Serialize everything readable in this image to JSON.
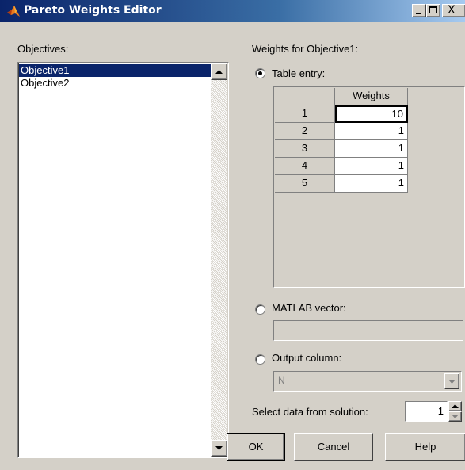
{
  "window": {
    "title": "Pareto Weights Editor",
    "controls": [
      "_",
      "□",
      "X"
    ]
  },
  "objectives": {
    "label": "Objectives:",
    "items": [
      "Objective1",
      "Objective2"
    ],
    "selected": "Objective1"
  },
  "weights": {
    "heading": "Weights for Objective1:",
    "table_entry_label": "Table entry:",
    "column_header": "Weights",
    "rows": [
      {
        "index": "1",
        "value": "10"
      },
      {
        "index": "2",
        "value": "1"
      },
      {
        "index": "3",
        "value": "1"
      },
      {
        "index": "4",
        "value": "1"
      },
      {
        "index": "5",
        "value": "1"
      }
    ],
    "matlab_vector_label": "MATLAB vector:",
    "matlab_vector_value": "",
    "output_column_label": "Output column:",
    "output_column_value": "N",
    "select_data_label": "Select data from solution:",
    "select_data_value": "1",
    "selected_mode": "Table entry"
  },
  "buttons": {
    "ok": "OK",
    "cancel": "Cancel",
    "help": "Help"
  },
  "colors": {
    "titlebar_start": "#0a246a",
    "titlebar_end": "#a6caf0",
    "selection": "#0a246a",
    "dialog_bg": "#d4d0c8"
  }
}
